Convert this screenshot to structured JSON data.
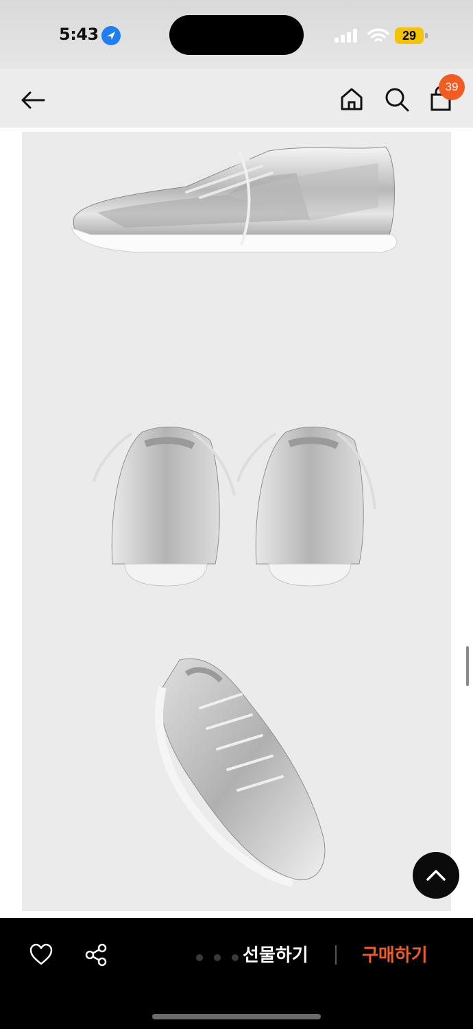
{
  "status_bar": {
    "time": "5:43",
    "battery_level": "29",
    "icons": [
      "location-arrow-icon",
      "cellular-signal-icon",
      "wifi-icon",
      "battery-icon"
    ]
  },
  "header": {
    "icons": [
      "back-arrow-icon",
      "home-icon",
      "search-icon",
      "shopping-bag-icon"
    ],
    "cart_count": "39"
  },
  "product_images": [
    "shoe-side-view",
    "shoe-back-view",
    "shoe-angled-view"
  ],
  "bottom_bar": {
    "gift_label": "선물하기",
    "buy_label": "구매하기",
    "icons": [
      "heart-icon",
      "share-icon"
    ]
  },
  "colors": {
    "accent": "#f25c23",
    "bottom_bar_bg": "#000000",
    "image_bg": "#ebebeb"
  }
}
